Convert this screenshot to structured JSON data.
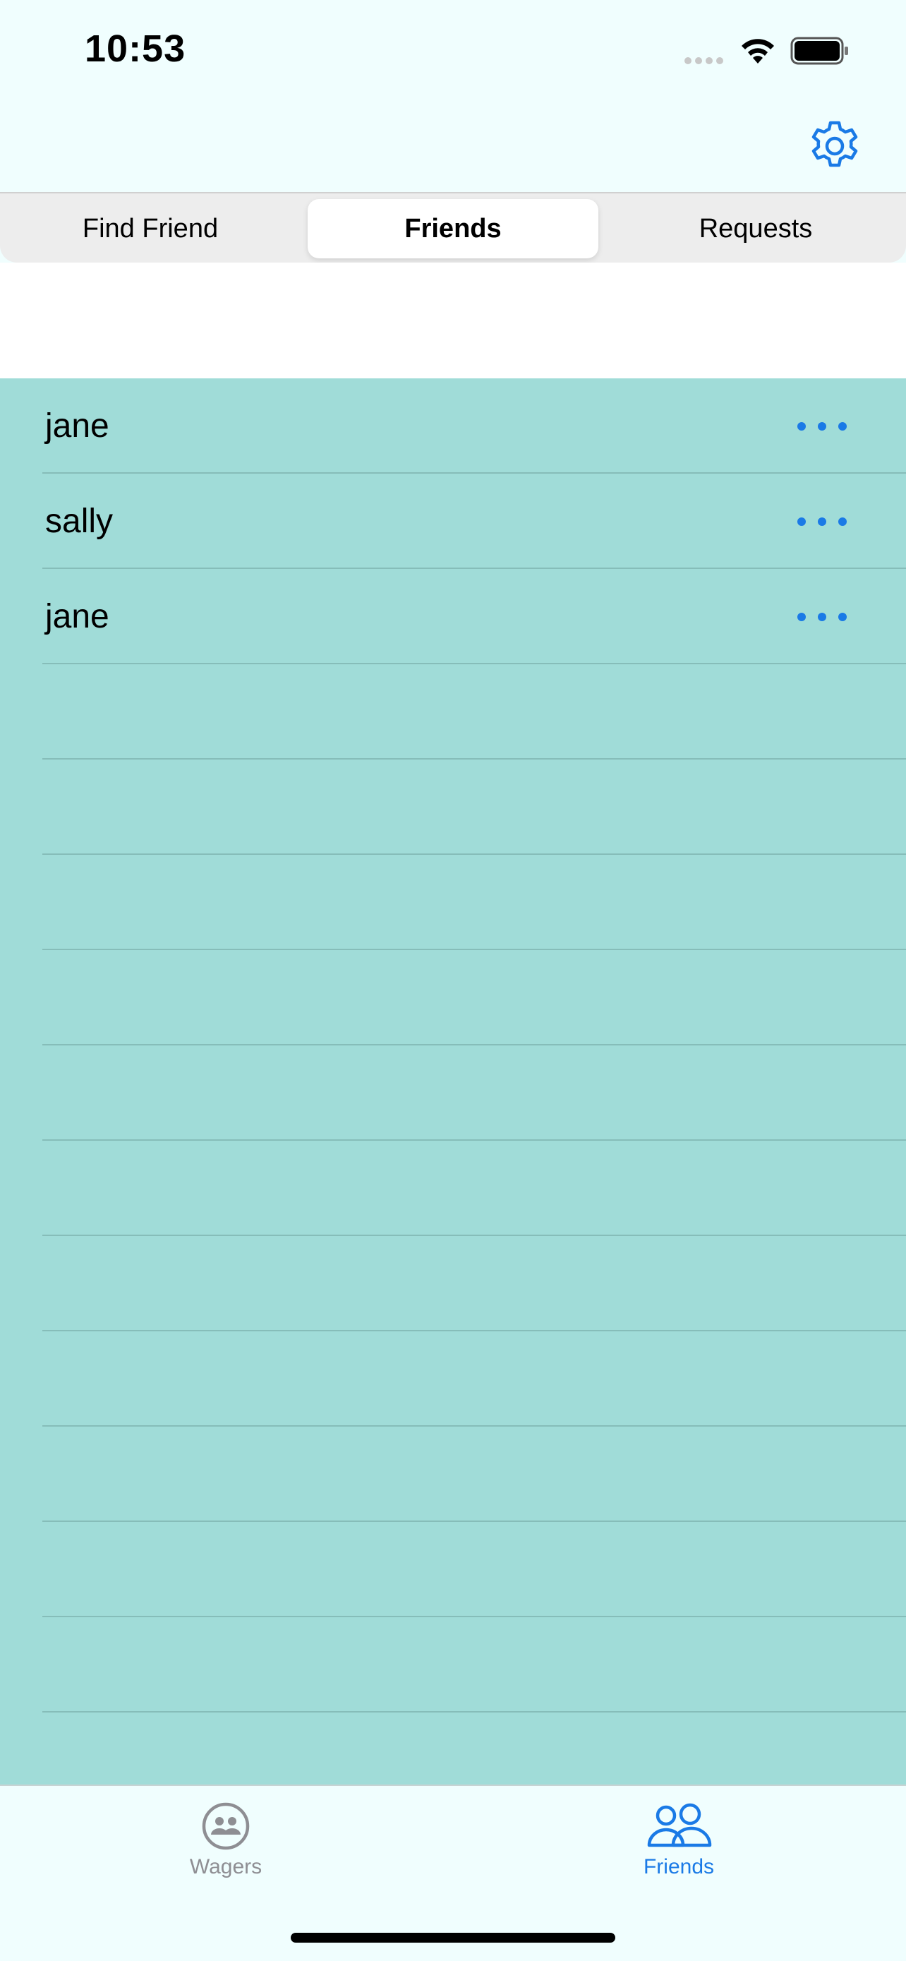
{
  "status_bar": {
    "time": "10:53",
    "icons": [
      "cellular-signal-icon",
      "wifi-icon",
      "battery-icon"
    ]
  },
  "nav": {
    "settings_icon": "gear-icon"
  },
  "segments": [
    {
      "label": "Find Friend",
      "selected": false
    },
    {
      "label": "Friends",
      "selected": true
    },
    {
      "label": "Requests",
      "selected": false
    }
  ],
  "friends": [
    {
      "name": "jane",
      "action_icon": "ellipsis-icon"
    },
    {
      "name": "sally",
      "action_icon": "ellipsis-icon"
    },
    {
      "name": "jane",
      "action_icon": "ellipsis-icon"
    }
  ],
  "tabbar": {
    "tabs": [
      {
        "label": "Wagers",
        "icon": "people-circle-icon",
        "active": false
      },
      {
        "label": "Friends",
        "icon": "two-people-icon",
        "active": true
      }
    ]
  },
  "colors": {
    "accent": "#1a7ae6",
    "background": "#f0fefe",
    "list_background": "#a0dcd8",
    "inactive_tab": "#8e8e93"
  }
}
